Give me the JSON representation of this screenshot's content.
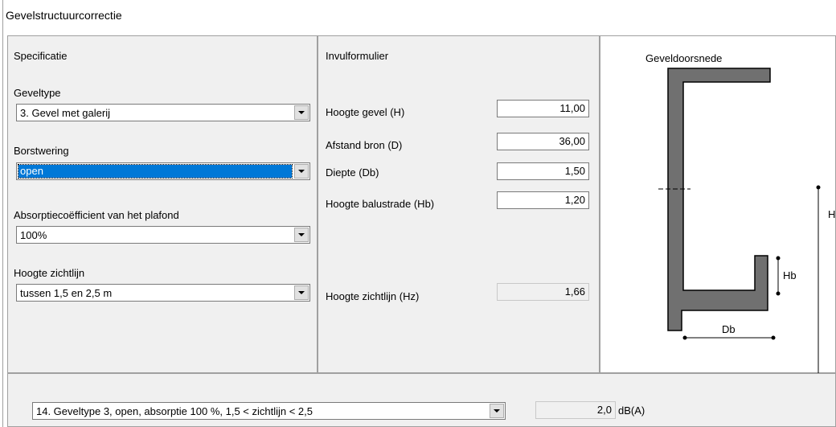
{
  "window": {
    "title": "Gevelstructuurcorrectie"
  },
  "specificatie": {
    "heading": "Specificatie",
    "geveltype": {
      "label": "Geveltype",
      "value": "3. Gevel met galerij"
    },
    "borstwering": {
      "label": "Borstwering",
      "value": "open"
    },
    "absorptie": {
      "label": "Absorptiecoëfficient van het plafond",
      "value": "100%"
    },
    "zichtlijn": {
      "label": "Hoogte zichtlijn",
      "value": "tussen 1,5 en 2,5 m"
    }
  },
  "invulformulier": {
    "heading": "Invulformulier",
    "hoogte_gevel": {
      "label": "Hoogte gevel (H)",
      "value": "11,00"
    },
    "afstand_bron": {
      "label": "Afstand bron (D)",
      "value": "36,00"
    },
    "diepte": {
      "label": "Diepte (Db)",
      "value": "1,50"
    },
    "hoogte_balustrade": {
      "label": "Hoogte balustrade (Hb)",
      "value": "1,20"
    },
    "hoogte_zichtlijn": {
      "label": "Hoogte zichtlijn (Hz)",
      "value": "1,66"
    }
  },
  "diagram": {
    "title": "Geveldoorsnede",
    "labels": {
      "h": "H",
      "hb": "Hb",
      "db": "Db"
    },
    "fill_color": "#707070"
  },
  "result": {
    "selection": "14. Geveltype 3, open, absorptie 100 %, 1,5 < zichtlijn < 2,5",
    "value": "2,0",
    "unit": "dB(A)"
  }
}
